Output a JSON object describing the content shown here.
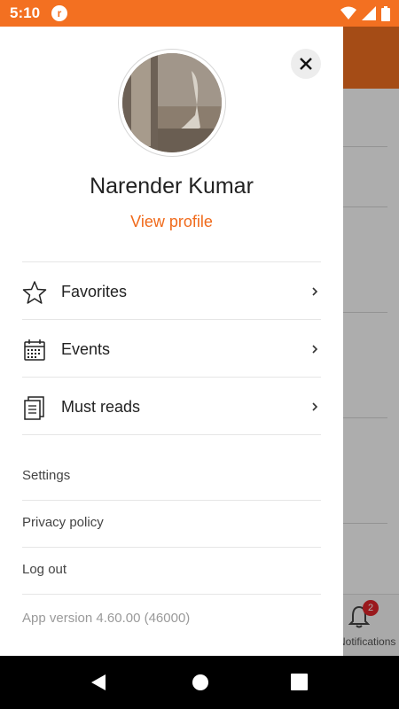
{
  "status_bar": {
    "time": "5:10",
    "app_icon_letter": "r"
  },
  "drawer": {
    "user_name": "Narender Kumar",
    "view_profile_label": "View profile",
    "menu_items": [
      {
        "label": "Favorites",
        "icon": "star-icon"
      },
      {
        "label": "Events",
        "icon": "calendar-icon"
      },
      {
        "label": "Must reads",
        "icon": "documents-icon"
      }
    ],
    "links": [
      {
        "label": "Settings"
      },
      {
        "label": "Privacy policy"
      },
      {
        "label": "Log out"
      }
    ],
    "app_version": "App version 4.60.00 (46000)"
  },
  "background_app": {
    "notifications_tab_label": "Notifications",
    "notifications_badge": "2"
  },
  "colors": {
    "accent": "#f37021",
    "link": "#f06a1b",
    "badge": "#e3262b"
  }
}
